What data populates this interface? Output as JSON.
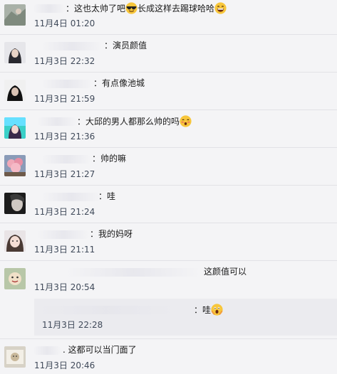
{
  "comments": [
    {
      "text": "：这也太帅了吧",
      "text2": "长成这样去踢球哈哈",
      "time": "11月4日 01:20",
      "emoji": "sunglasses-face",
      "emoji2": "grinning-face"
    },
    {
      "text": "：演员颜值",
      "time": "11月3日 22:32"
    },
    {
      "text": "：有点像池城",
      "time": "11月3日 21:59"
    },
    {
      "text": "：大邱的男人都那么帅的吗",
      "time": "11月3日 21:36",
      "emoji": "blushing-face"
    },
    {
      "text": "：帅的嘛",
      "time": "11月3日 21:27"
    },
    {
      "text": "：哇",
      "time": "11月3日 21:24"
    },
    {
      "text": "：我的妈呀",
      "time": "11月3日 21:11"
    },
    {
      "text": "这颜值可以",
      "time": "11月3日 20:54"
    },
    {
      "text": ". 这都可以当门面了",
      "time": "11月3日 20:46"
    }
  ],
  "reply": {
    "text": "：哇",
    "time": "11月3日 22:28",
    "emoji": "screaming-face"
  },
  "colors": {
    "background": "#f4f4f6",
    "reply_background": "#ebebef",
    "time_text": "#404a5a"
  }
}
